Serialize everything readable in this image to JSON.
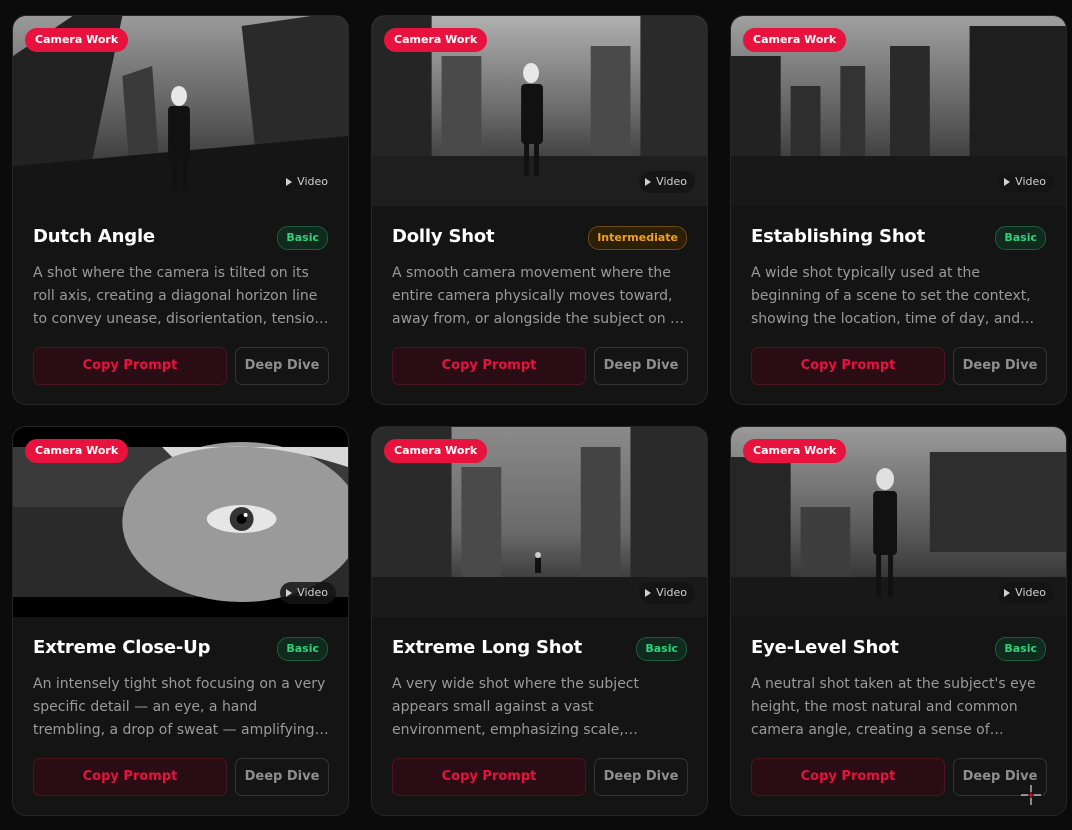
{
  "cards": [
    {
      "tag": "Camera Work",
      "video": "Video",
      "title": "Dutch Angle",
      "level": "Basic",
      "level_color": "#2fd37a",
      "desc": "A shot where the camera is tilted on its roll axis, creating a diagonal horizon line to convey unease, disorientation, tension, or instability.",
      "copy": "Copy Prompt",
      "deep": "Deep Dive",
      "image_icon": "tilted-city-figure"
    },
    {
      "tag": "Camera Work",
      "video": "Video",
      "title": "Dolly Shot",
      "level": "Intermediate",
      "level_color": "#f0a020",
      "desc": "A smooth camera movement where the entire camera physically moves toward, away from, or alongside the subject on a track.",
      "copy": "Copy Prompt",
      "deep": "Deep Dive",
      "image_icon": "figure-in-street"
    },
    {
      "tag": "Camera Work",
      "video": "Video",
      "title": "Establishing Shot",
      "level": "Basic",
      "level_color": "#2fd37a",
      "desc": "A wide shot typically used at the beginning of a scene to set the context, showing the location, time of day, and atmosphere.",
      "copy": "Copy Prompt",
      "deep": "Deep Dive",
      "image_icon": "city-skyline"
    },
    {
      "tag": "Camera Work",
      "video": "Video",
      "title": "Extreme Close-Up",
      "level": "Basic",
      "level_color": "#2fd37a",
      "desc": "An intensely tight shot focusing on a very specific detail — an eye, a hand trembling, a drop of sweat — amplifying emotion.",
      "copy": "Copy Prompt",
      "deep": "Deep Dive",
      "image_icon": "eye-closeup"
    },
    {
      "tag": "Camera Work",
      "video": "Video",
      "title": "Extreme Long Shot",
      "level": "Basic",
      "level_color": "#2fd37a",
      "desc": "A very wide shot where the subject appears small against a vast environment, emphasizing scale, isolation, or grandeur.",
      "copy": "Copy Prompt",
      "deep": "Deep Dive",
      "image_icon": "tiny-figure-vast-city"
    },
    {
      "tag": "Camera Work",
      "video": "Video",
      "title": "Eye-Level Shot",
      "level": "Basic",
      "level_color": "#2fd37a",
      "desc": "A neutral shot taken at the subject's eye height, the most natural and common camera angle, creating a sense of realism.",
      "copy": "Copy Prompt",
      "deep": "Deep Dive",
      "image_icon": "figure-eye-level"
    }
  ]
}
